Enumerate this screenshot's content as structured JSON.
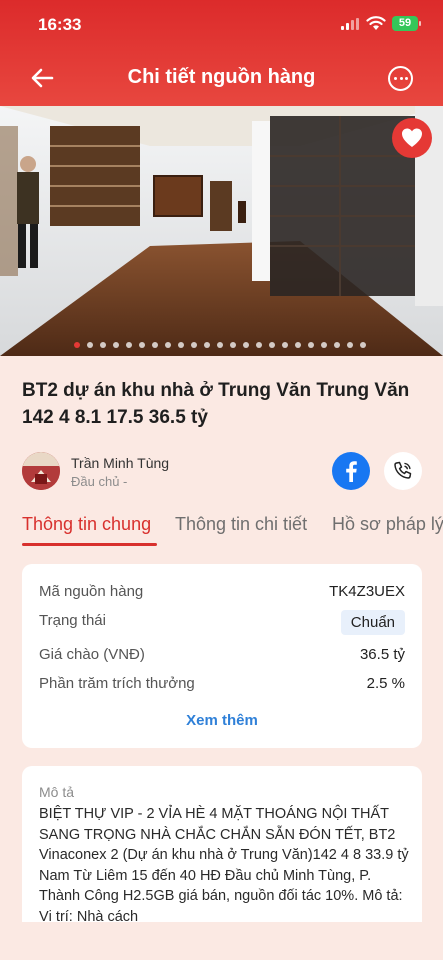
{
  "status_bar": {
    "time": "16:33",
    "battery": "59"
  },
  "header": {
    "title": "Chi tiết nguồn hàng"
  },
  "gallery": {
    "total_images": 23,
    "active_index": 0
  },
  "listing": {
    "title": "BT2 dự án khu nhà ở Trung Văn Trung Văn 142 4 8.1 17.5 36.5 tỷ"
  },
  "owner": {
    "name": "Trần Minh Tùng",
    "role": "Đầu chủ -"
  },
  "tabs": [
    {
      "label": "Thông tin chung"
    },
    {
      "label": "Thông tin chi tiết"
    },
    {
      "label": "Hồ sơ pháp lý"
    }
  ],
  "info": {
    "rows": [
      {
        "label": "Mã nguồn hàng",
        "value": "TK4Z3UEX"
      },
      {
        "label": "Trạng thái",
        "value": "Chuẩn"
      },
      {
        "label": "Giá chào (VNĐ)",
        "value": "36.5 tỷ"
      },
      {
        "label": "Phần trăm trích thưởng",
        "value": "2.5 %"
      }
    ],
    "see_more": "Xem thêm"
  },
  "description": {
    "label": "Mô tả",
    "text": "BIỆT THỰ VIP - 2 VỈA HÈ 4 MẶT THOÁNG NỘI THẤT SANG TRỌNG NHÀ CHẮC CHẮN SẴN ĐÓN TẾT, BT2 Vinaconex 2 (Dự án khu nhà ở Trung Văn)142 4 8 33.9 tỷ Nam Từ Liêm 15 đến 40 HĐ Đầu chủ Minh Tùng, P. Thành Công H2.5GB giá bán, nguồn đối tác 10%. Mô tả: Vị trí: Nhà cách"
  },
  "colors": {
    "brand": "#dc2b2b",
    "link": "#2f80d8",
    "facebook": "#1877f2"
  }
}
